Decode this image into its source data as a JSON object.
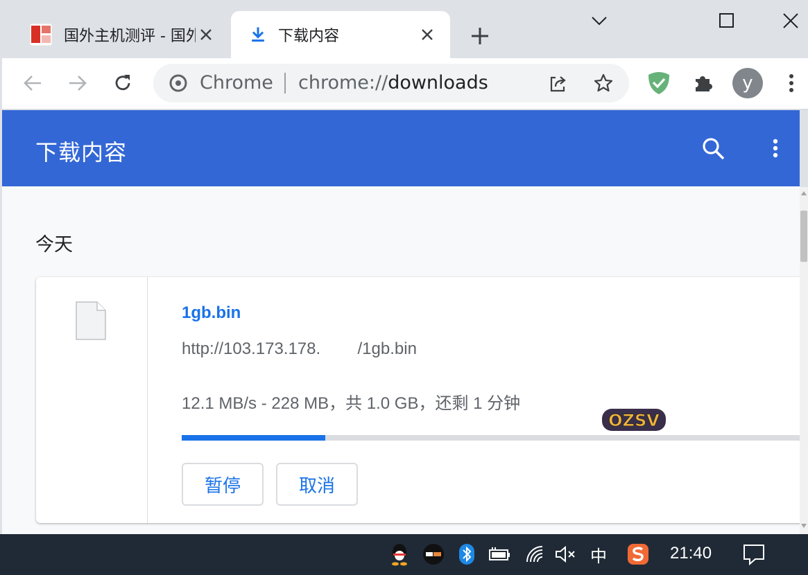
{
  "tabs": [
    {
      "title": "国外主机测评 - 国外",
      "active": false,
      "icon": "zhuji-favicon-icon"
    },
    {
      "title": "下载内容",
      "active": true,
      "icon": "download-icon"
    }
  ],
  "window": {
    "minimize_icon": "chevron-down-icon",
    "maximize_icon": "square-icon",
    "close_icon": "close-icon"
  },
  "omnibox": {
    "site_label": "Chrome",
    "url_scheme": "chrome://",
    "url_host": "downloads"
  },
  "avatar": {
    "letter": "y"
  },
  "appbar": {
    "title": "下载内容"
  },
  "section": {
    "date": "今天"
  },
  "download": {
    "file_name": "1gb.bin",
    "url": "http://103.173.178.        /1gb.bin",
    "status": "12.1 MB/s - 228 MB，共 1.0 GB，还剩 1 分钟",
    "progress_fraction": 0.228,
    "buttons": {
      "pause": "暂停",
      "cancel": "取消"
    }
  },
  "taskbar": {
    "ime": "中",
    "clock": "21:40"
  },
  "colors": {
    "accent": "#3367d6",
    "link": "#1a73e8",
    "taskbar": "#202a36"
  }
}
